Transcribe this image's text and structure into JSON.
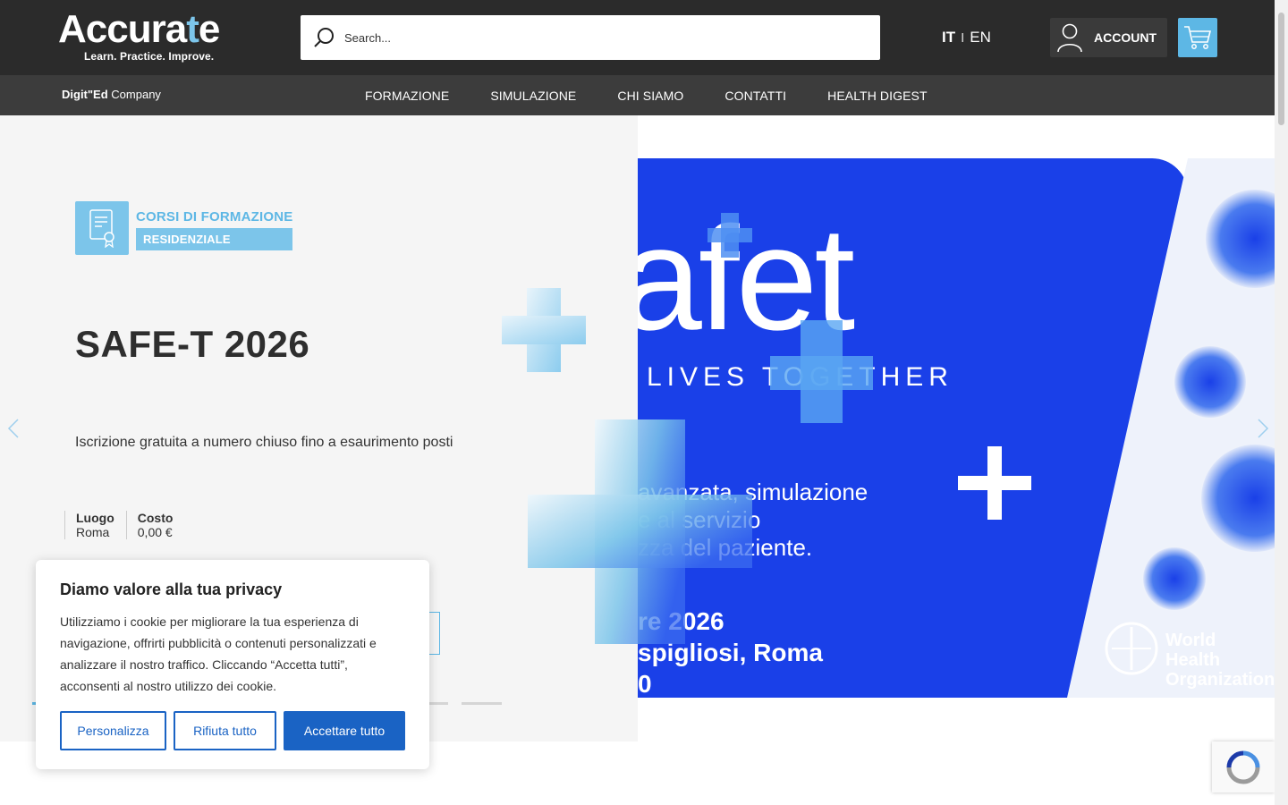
{
  "header": {
    "logo_word_a": "Accura",
    "logo_word_t": "t",
    "logo_word_b": "e",
    "logo_tagline": "Learn. Practice. Improve.",
    "search_placeholder": "Search...",
    "lang_it": "IT",
    "lang_sep": "I",
    "lang_en": "EN",
    "account_label": "ACCOUNT"
  },
  "subheader": {
    "company_brand": "Digit\"Ed",
    "company_word": "Company",
    "nav": [
      "FORMAZIONE",
      "SIMULAZIONE",
      "CHI SIAMO",
      "CONTATTI",
      "HEALTH DIGEST"
    ]
  },
  "hero": {
    "category": "CORSI DI FORMAZIONE",
    "category_tag": "RESIDENZIALE",
    "title": "SAFE-T 2026",
    "subtitle": "Iscrizione gratuita a numero chiuso fino a esaurimento posti",
    "meta": [
      {
        "label": "Luogo",
        "value": "Roma"
      },
      {
        "label": "Costo",
        "value": "0,00 €"
      }
    ],
    "slides_total": 9,
    "slide_active": 1
  },
  "banner": {
    "word": "afet",
    "tagline": "LIVES TOGETHER",
    "desc_lines": [
      "avanzata, simulazione",
      "e al servizio",
      "zza del paziente."
    ],
    "date_lines": [
      "re 2026",
      "spigliosi, Roma",
      "0"
    ],
    "org_lines": [
      "World Health",
      "Organization"
    ]
  },
  "cookie": {
    "title": "Diamo valore alla tua privacy",
    "text": "Utilizziamo i cookie per migliorare la tua esperienza di navigazione, offrirti pubblicità o contenuti personalizzati e analizzare il nostro traffico. Cliccando “Accetta tutti”, acconsenti al nostro utilizzo dei cookie.",
    "btn_customize": "Personalizza",
    "btn_reject": "Rifiuta tutto",
    "btn_accept": "Accettare tutto"
  },
  "colors": {
    "header_bg": "#2b2b2b",
    "nav_bg": "#3c3c3c",
    "accent": "#5db7e5",
    "accent_light": "#7cc5ea",
    "banner_blue": "#1a40e8",
    "cookie_button": "#1a63c4"
  }
}
